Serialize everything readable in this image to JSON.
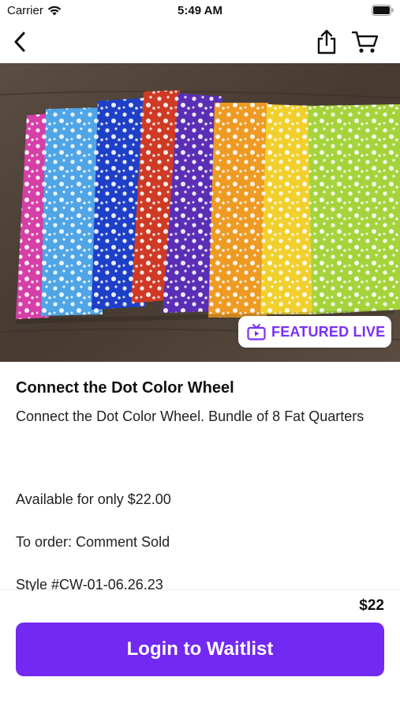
{
  "status_bar": {
    "carrier": "Carrier",
    "time": "5:49 AM"
  },
  "nav": {
    "back_icon": "chevron-left-icon",
    "share_icon": "share-icon",
    "cart_icon": "cart-icon"
  },
  "product": {
    "image_icon": "fabric-bundle-photo",
    "featured_badge": "FEATURED LIVE",
    "featured_icon": "tv-icon",
    "title": "Connect the Dot Color Wheel",
    "description": "Connect the Dot Color Wheel. Bundle of 8 Fat Quarters",
    "details": [
      "Available for only $22.00",
      "To order: Comment Sold",
      "Style #CW-01-06.26.23"
    ],
    "price": "$22"
  },
  "actions": {
    "waitlist_label": "Login to Waitlist"
  },
  "colors": {
    "accent": "#7229f2",
    "badge_text": "#7b2ff7"
  }
}
